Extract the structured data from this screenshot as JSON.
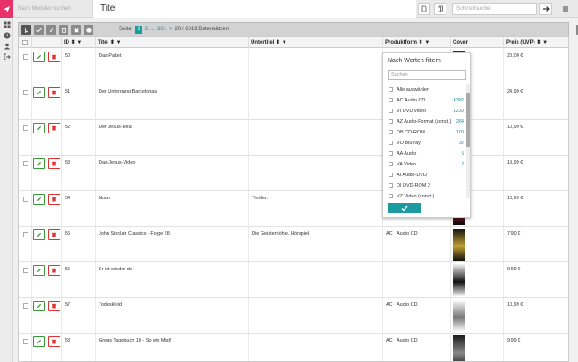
{
  "header": {
    "module_search_placeholder": "Nach Modulen suchen",
    "title": "Titel",
    "quick_search_placeholder": "Schnellsuche"
  },
  "pager": {
    "label": "Seite:",
    "current": "1",
    "next": "2",
    "dots": "...",
    "last": "301",
    "arrow": ">",
    "records": "20 / 6019 Datensätzen"
  },
  "columns": {
    "id": "ID",
    "titel": "Titel",
    "untertitel": "Untertitel",
    "produktform": "Produktform",
    "cover": "Cover",
    "preis": "Preis (UVP)"
  },
  "rows": [
    {
      "id": "50",
      "titel": "Das Paket",
      "untertitel": "",
      "pf_code": "",
      "pf_name": "",
      "preis": "20,00 €"
    },
    {
      "id": "51",
      "titel": "Der Untergang Barcelonas",
      "untertitel": "",
      "pf_code": "",
      "pf_name": "",
      "preis": "24,99 €"
    },
    {
      "id": "52",
      "titel": "Der Jesus-Deal",
      "untertitel": "",
      "pf_code": "",
      "pf_name": "",
      "preis": "10,99 €"
    },
    {
      "id": "53",
      "titel": "Das Jesus-Video",
      "untertitel": "",
      "pf_code": "",
      "pf_name": "",
      "preis": "19,99 €"
    },
    {
      "id": "54",
      "titel": "Noah",
      "untertitel": "Thriller.",
      "pf_code": "",
      "pf_name": "",
      "preis": "10,99 €"
    },
    {
      "id": "55",
      "titel": "John Sinclair Classics - Folge 28",
      "untertitel": "Die Geisterhöhle. Hörspiel.",
      "pf_code": "AC",
      "pf_name": "Audio CD",
      "preis": "7,90 €"
    },
    {
      "id": "56",
      "titel": "Er ist wieder da",
      "untertitel": "",
      "pf_code": "",
      "pf_name": "",
      "preis": "9,99 €"
    },
    {
      "id": "57",
      "titel": "Todeskleid",
      "untertitel": "",
      "pf_code": "AC",
      "pf_name": "Audio CD",
      "preis": "10,99 €"
    },
    {
      "id": "58",
      "titel": "Gregs Tagebuch 10 - So ein Mist!",
      "untertitel": "",
      "pf_code": "AC",
      "pf_name": "Audio CD",
      "preis": "9,99 €"
    }
  ],
  "filter": {
    "title": "Nach Werten filtern",
    "search_placeholder": "Suchen",
    "items": [
      {
        "label": "Alle auswählen",
        "count": ""
      },
      {
        "label": "AC Audio CD",
        "count": "4382"
      },
      {
        "label": "VI DVD video",
        "count": "1230"
      },
      {
        "label": "AZ Audio-Format (sonst.)",
        "count": "264"
      },
      {
        "label": "DB CD-ROM",
        "count": "100"
      },
      {
        "label": "VO Blu-ray",
        "count": "32"
      },
      {
        "label": "AA Audio",
        "count": "5"
      },
      {
        "label": "VA Video",
        "count": "2"
      },
      {
        "label": "AI Audio-DVD",
        "count": ""
      },
      {
        "label": "DI DVD-ROM 2",
        "count": ""
      },
      {
        "label": "VZ Video (sonst.)",
        "count": ""
      }
    ]
  },
  "colors": {
    "accent": "#1b9aa0",
    "logo": "#e8336a",
    "edit": "#3a9a3a",
    "delete": "#d33333"
  }
}
